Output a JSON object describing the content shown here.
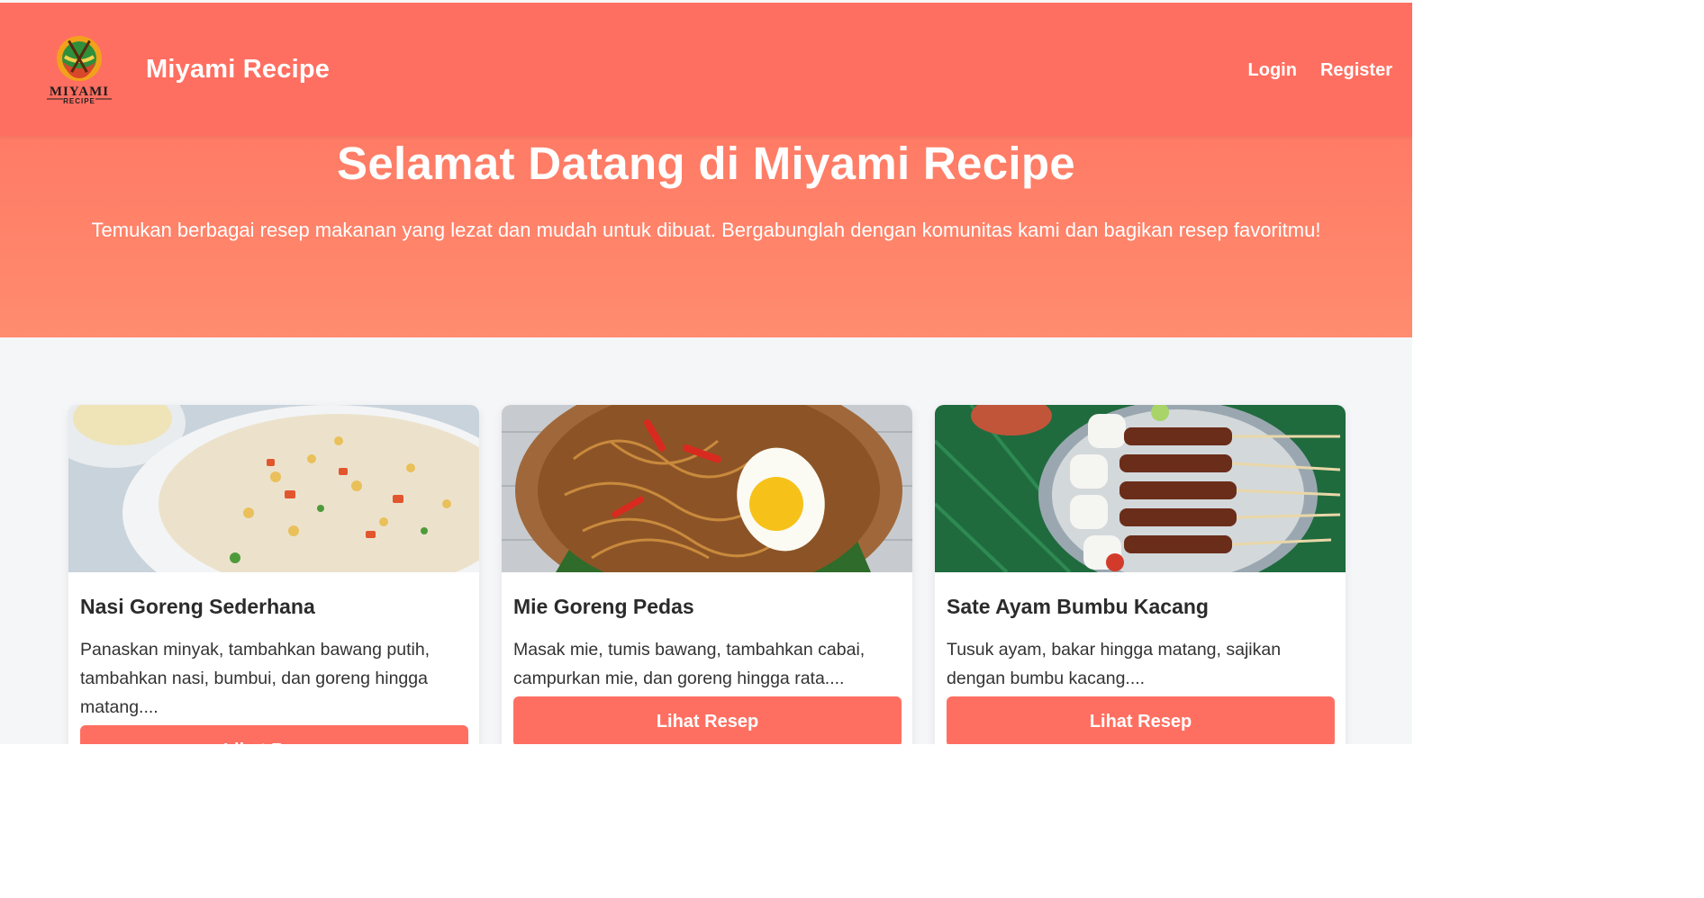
{
  "header": {
    "brand": "Miyami Recipe",
    "logo_title": "MIYAMI",
    "logo_sub": "RECIPE",
    "nav": [
      {
        "label": "Login"
      },
      {
        "label": "Register"
      }
    ]
  },
  "hero": {
    "title": "Selamat Datang di Miyami Recipe",
    "subtitle": "Temukan berbagai resep makanan yang lezat dan mudah untuk dibuat. Bergabunglah dengan komunitas kami dan bagikan resep favoritmu!"
  },
  "recipes": [
    {
      "title": "Nasi Goreng Sederhana",
      "description": "Panaskan minyak, tambahkan bawang putih, tambahkan nasi, bumbui, dan goreng hingga matang....",
      "button": "Lihat Resep",
      "image": "fried-rice-photo"
    },
    {
      "title": "Mie Goreng Pedas",
      "description": "Masak mie, tumis bawang, tambahkan cabai, campurkan mie, dan goreng hingga rata....",
      "button": "Lihat Resep",
      "image": "fried-noodles-photo"
    },
    {
      "title": "Sate Ayam Bumbu Kacang",
      "description": "Tusuk ayam, bakar hingga matang, sajikan dengan bumbu kacang....",
      "button": "Lihat Resep",
      "image": "chicken-satay-photo"
    }
  ],
  "colors": {
    "primary": "#ff6f61",
    "hero_bottom": "#ff8c6e",
    "page_bg": "#f5f6f8"
  }
}
